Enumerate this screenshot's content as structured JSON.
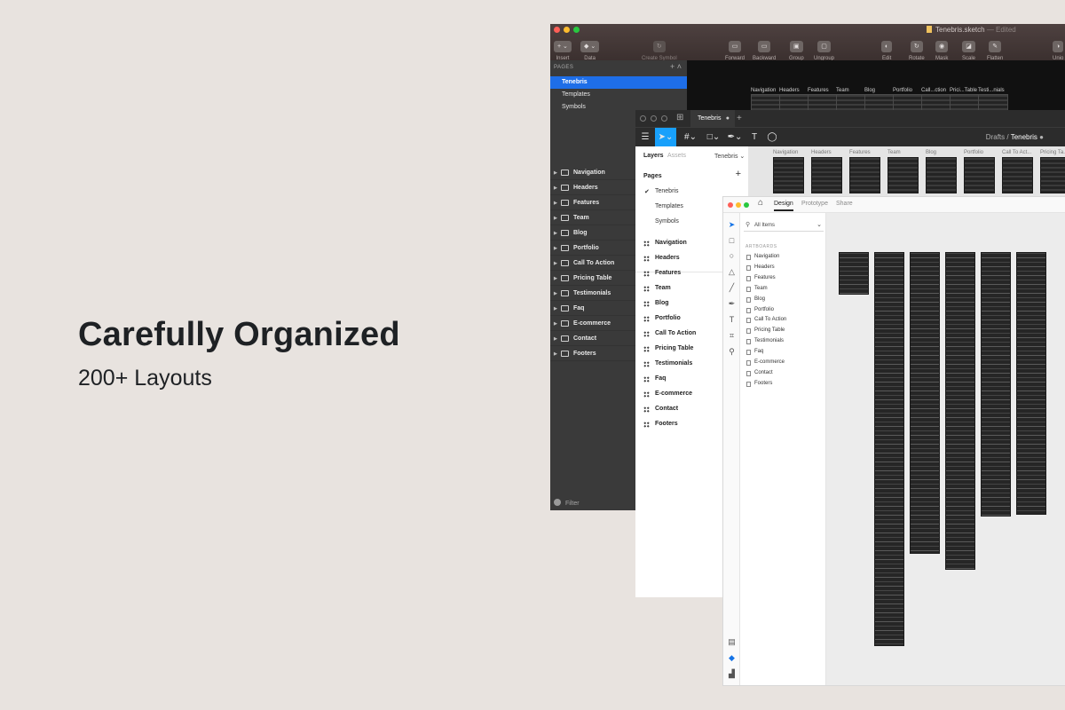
{
  "hero": {
    "title": "Carefully Organized",
    "subtitle": "200+ Layouts"
  },
  "colors": {
    "sketch_selection": "#1e6ee8",
    "figma_tool_active": "#18a0fb",
    "xd_accent": "#1473e6"
  },
  "sketch": {
    "window_title": "Tenebris.sketch",
    "edited_label": "— Edited",
    "toolbar": [
      {
        "icon": "plus-icon",
        "glyph": "+ ⌄",
        "label": "Insert"
      },
      {
        "icon": "data-icon",
        "glyph": "◆ ⌄",
        "label": "Data"
      },
      {
        "icon": "symbol-icon",
        "glyph": "↻",
        "label": "Create Symbol"
      },
      {
        "icon": "forward-icon",
        "glyph": "▭",
        "label": "Forward"
      },
      {
        "icon": "backward-icon",
        "glyph": "▭",
        "label": "Backward"
      },
      {
        "icon": "group-icon",
        "glyph": "▣",
        "label": "Group"
      },
      {
        "icon": "ungroup-icon",
        "glyph": "▢",
        "label": "Ungroup"
      },
      {
        "icon": "edit-icon",
        "glyph": "◐",
        "label": "Edit"
      },
      {
        "icon": "rotate-icon",
        "glyph": "↻",
        "label": "Rotate"
      },
      {
        "icon": "mask-icon",
        "glyph": "◉",
        "label": "Mask"
      },
      {
        "icon": "scale-icon",
        "glyph": "◪",
        "label": "Scale"
      },
      {
        "icon": "flatten-icon",
        "glyph": "✎",
        "label": "Flatten"
      },
      {
        "icon": "union-icon",
        "glyph": "◑",
        "label": "Unio"
      }
    ],
    "pages_header": "PAGES",
    "pages": [
      "Tenebris",
      "Templates",
      "Symbols"
    ],
    "layers": [
      "Navigation",
      "Headers",
      "Features",
      "Team",
      "Blog",
      "Portfolio",
      "Call To Action",
      "Pricing Table",
      "Testimonials",
      "Faq",
      "E-commerce",
      "Contact",
      "Footers"
    ],
    "filter_label": "Filter",
    "artboards": [
      "Navigation",
      "Headers",
      "Features",
      "Team",
      "Blog",
      "Portfolio",
      "Call...ction",
      "Prici...Table",
      "Testi...nials"
    ]
  },
  "figma": {
    "tab_title": "Tenebris",
    "breadcrumb_parent": "Drafts",
    "breadcrumb_sep": "/",
    "breadcrumb_current": "Tenebris",
    "panel_tabs": {
      "layers": "Layers",
      "assets": "Assets",
      "file": "Tenebris"
    },
    "pages_header": "Pages",
    "pages": [
      "Tenebris",
      "Templates",
      "Symbols"
    ],
    "layers": [
      "Navigation",
      "Headers",
      "Features",
      "Team",
      "Blog",
      "Portfolio",
      "Call To Action",
      "Pricing Table",
      "Testimonials",
      "Faq",
      "E-commerce",
      "Contact",
      "Footers"
    ],
    "artboards": [
      "Navigation",
      "Headers",
      "Features",
      "Team",
      "Blog",
      "Portfolio",
      "Call To Act...",
      "Pricing Ta..."
    ]
  },
  "xd": {
    "tabs": [
      "Design",
      "Prototype",
      "Share"
    ],
    "search_placeholder": "All Items",
    "artboards_header": "ARTBOARDS",
    "artboards": [
      "Navigation",
      "Headers",
      "Features",
      "Team",
      "Blog",
      "Portfolio",
      "Call To Action",
      "Pricing Table",
      "Testimonials",
      "Faq",
      "E-commerce",
      "Contact",
      "Footers"
    ]
  }
}
